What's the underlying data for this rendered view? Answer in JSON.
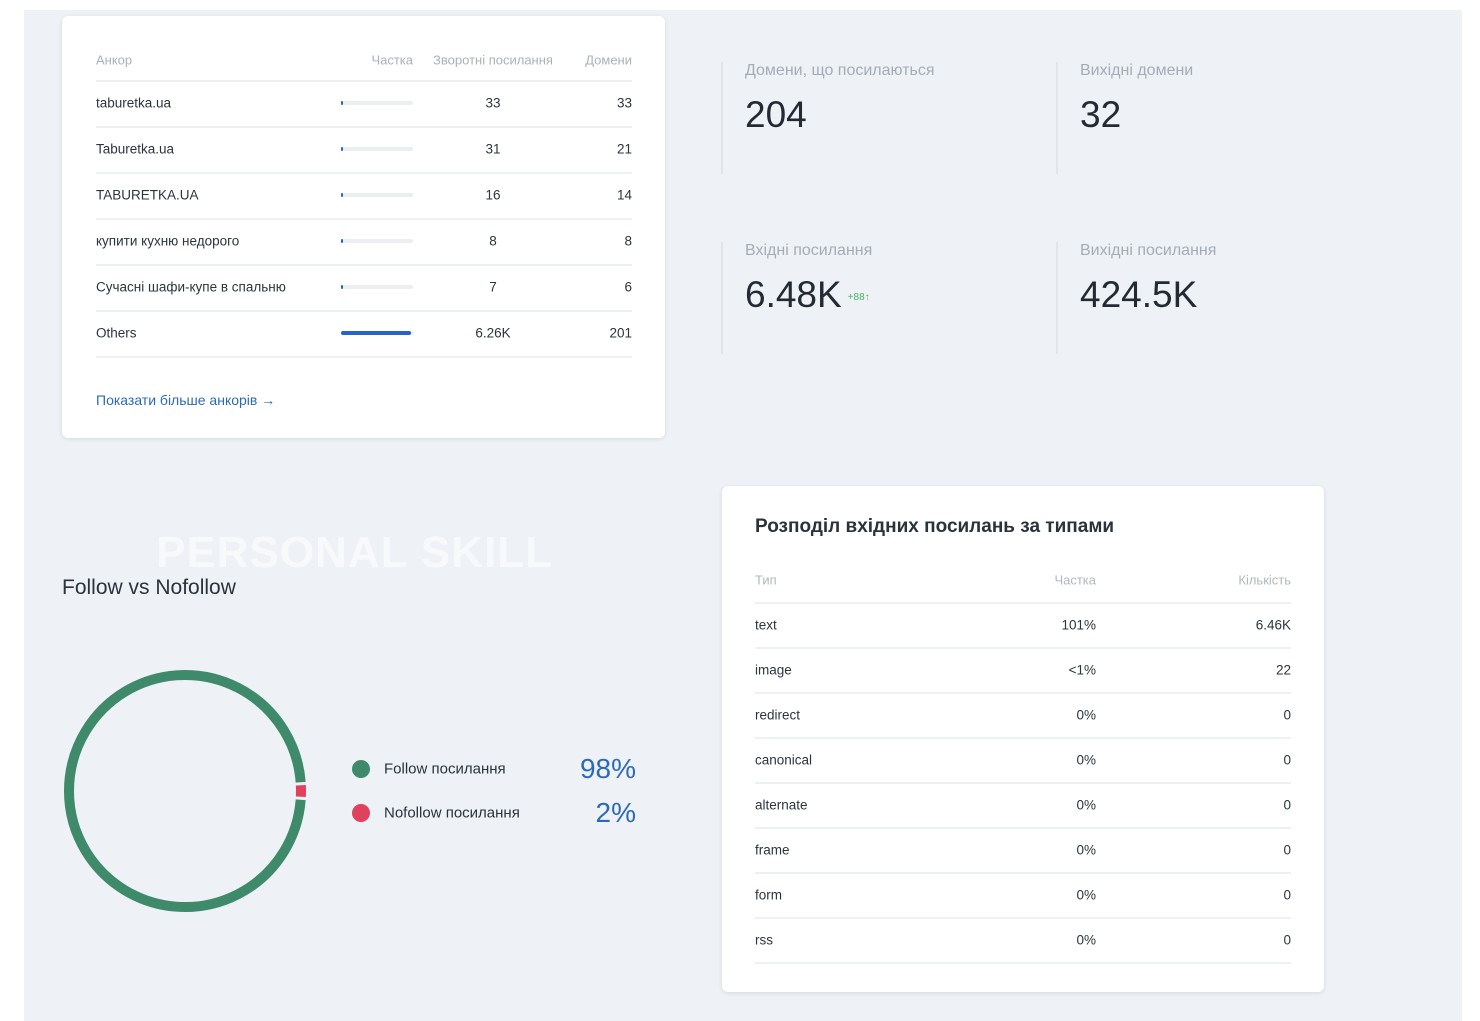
{
  "anchors": {
    "headers": {
      "anchor": "Анкор",
      "share": "Частка",
      "backlinks": "Зворотні посилання",
      "domains": "Домени"
    },
    "rows": [
      {
        "anchor": "taburetka.ua",
        "share": 0.03,
        "backlinks": "33",
        "domains": "33"
      },
      {
        "anchor": "Taburetka.ua",
        "share": 0.02,
        "backlinks": "31",
        "domains": "21"
      },
      {
        "anchor": "TABURETKA.UA",
        "share": 0.01,
        "backlinks": "16",
        "domains": "14"
      },
      {
        "anchor": "купити кухню недорого",
        "share": 0.005,
        "backlinks": "8",
        "domains": "8"
      },
      {
        "anchor": "Сучасні шафи-купе в спальню",
        "share": 0.005,
        "backlinks": "7",
        "domains": "6"
      },
      {
        "anchor": "Others",
        "share": 0.97,
        "backlinks": "6.26K",
        "domains": "201"
      }
    ],
    "more_link": "Показати більше анкорів →"
  },
  "stats": {
    "referring_domains": {
      "label": "Домени, що посилаються",
      "value": "204"
    },
    "outgoing_domains": {
      "label": "Вихідні домени",
      "value": "32"
    },
    "incoming_links": {
      "label": "Вхідні посилання",
      "value": "6.48K",
      "delta": "+88↑"
    },
    "outgoing_links": {
      "label": "Вихідні посилання",
      "value": "424.5K"
    }
  },
  "types": {
    "title": "Розподіл вхідних посилань за типами",
    "headers": {
      "type": "Тип",
      "share": "Частка",
      "count": "Кількість"
    },
    "rows": [
      {
        "type": "text",
        "share": "101%",
        "count": "6.46K"
      },
      {
        "type": "image",
        "share": "<1%",
        "count": "22"
      },
      {
        "type": "redirect",
        "share": "0%",
        "count": "0"
      },
      {
        "type": "canonical",
        "share": "0%",
        "count": "0"
      },
      {
        "type": "alternate",
        "share": "0%",
        "count": "0"
      },
      {
        "type": "frame",
        "share": "0%",
        "count": "0"
      },
      {
        "type": "form",
        "share": "0%",
        "count": "0"
      },
      {
        "type": "rss",
        "share": "0%",
        "count": "0"
      }
    ]
  },
  "follow": {
    "title": "Follow vs Nofollow",
    "items": [
      {
        "label": "Follow посилання",
        "percent_text": "98%",
        "value": 98,
        "color": "#3f8a6a"
      },
      {
        "label": "Nofollow посилання",
        "percent_text": "2%",
        "value": 2,
        "color": "#e0415c"
      }
    ]
  },
  "watermark": "PERSONAL SKILL",
  "colors": {
    "accent": "#2d6ab5",
    "share_bar": "#2563c9",
    "delta_green": "#4caf6a"
  }
}
